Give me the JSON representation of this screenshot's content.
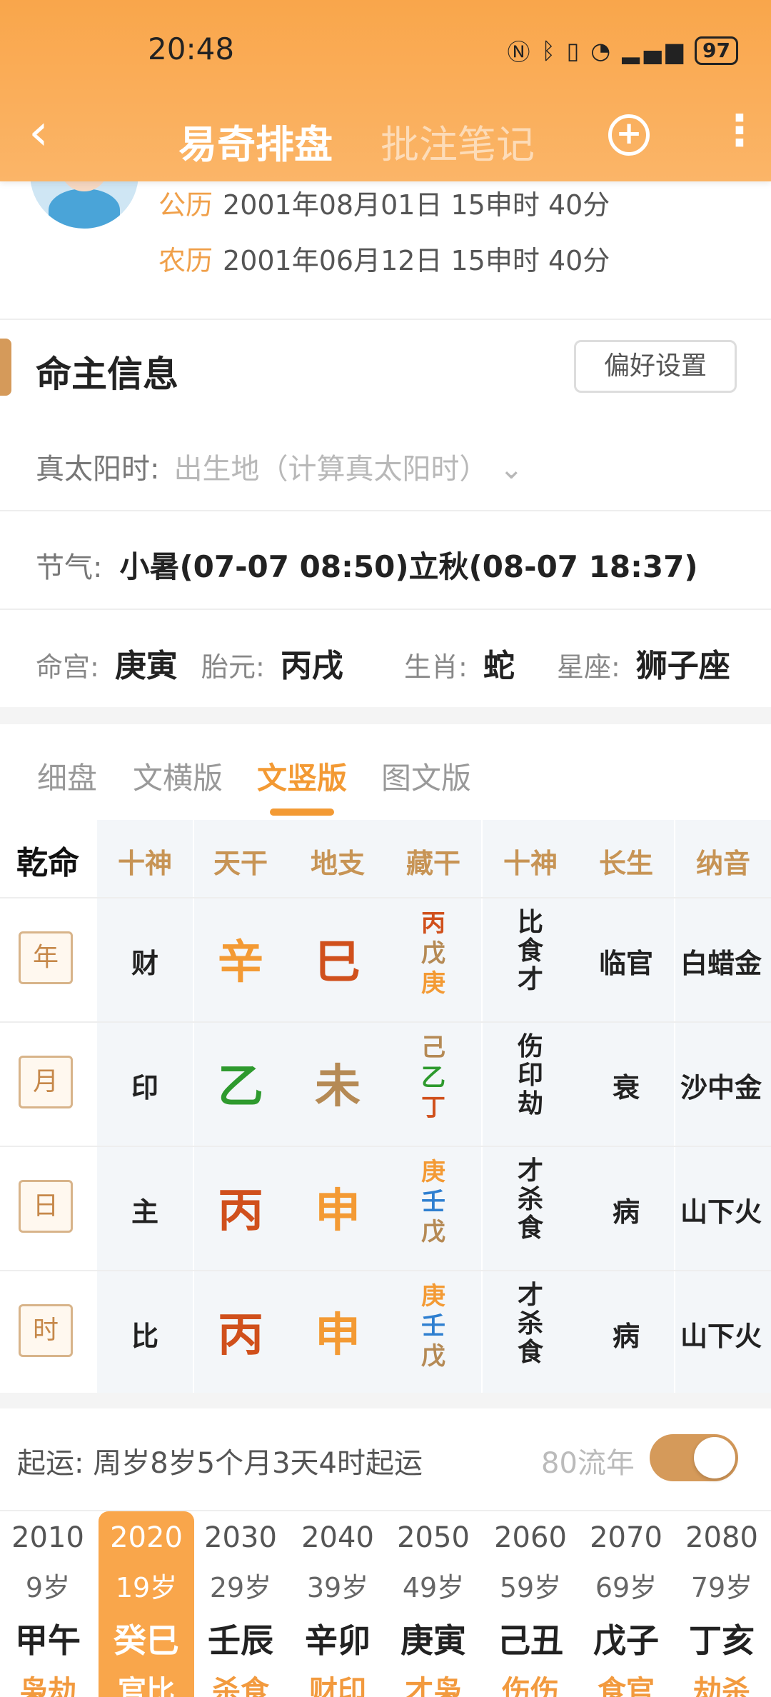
{
  "status": {
    "time": "20:48",
    "battery": "97",
    "icons": "NFC · BT · vibrate · wifi · 5G"
  },
  "nav": {
    "active_tab": "易奇排盘",
    "tab2": "批注笔记",
    "back": "‹",
    "more": "⋮",
    "plus": "+"
  },
  "birth": {
    "gongli_label": "公历",
    "gongli": "2001年08月01日 15申时 40分",
    "nongli_label": "农历",
    "nongli": "2001年06月12日 15申时 40分"
  },
  "section": {
    "title": "命主信息",
    "pref_button": "偏好设置"
  },
  "solar_time": {
    "label": "真太阳时:",
    "placeholder": "出生地（计算真太阳时）",
    "chevron": "⌄"
  },
  "jieqi": {
    "label": "节气:",
    "value": "小暑(07-07 08:50)立秋(08-07 18:37)"
  },
  "info": {
    "minggong_label": "命宫:",
    "minggong": "庚寅",
    "taiyuan_label": "胎元:",
    "taiyuan": "丙戌",
    "shengxiao_label": "生肖:",
    "shengxiao": "蛇",
    "xingzuo_label": "星座:",
    "xingzuo": "狮子座"
  },
  "view_tabs": [
    "细盘",
    "文横版",
    "文竖版",
    "图文版"
  ],
  "chart": {
    "headers": [
      "乾命",
      "十神",
      "天干",
      "地支",
      "藏干",
      "十神",
      "长生",
      "纳音"
    ],
    "rows": [
      {
        "pillar": "年",
        "shishen": "财",
        "gan": "辛",
        "zhi": "巳",
        "zang": [
          "丙",
          "戊",
          "庚"
        ],
        "ss": [
          "比",
          "食",
          "才"
        ],
        "cs": "临官",
        "ny": "白蜡金"
      },
      {
        "pillar": "月",
        "shishen": "印",
        "gan": "乙",
        "zhi": "未",
        "zang": [
          "己",
          "乙",
          "丁"
        ],
        "ss": [
          "伤",
          "印",
          "劫"
        ],
        "cs": "衰",
        "ny": "沙中金"
      },
      {
        "pillar": "日",
        "shishen": "主",
        "gan": "丙",
        "zhi": "申",
        "zang": [
          "庚",
          "壬",
          "戊"
        ],
        "ss": [
          "才",
          "杀",
          "食"
        ],
        "cs": "病",
        "ny": "山下火"
      },
      {
        "pillar": "时",
        "shishen": "比",
        "gan": "丙",
        "zhi": "申",
        "zang": [
          "庚",
          "壬",
          "戊"
        ],
        "ss": [
          "才",
          "杀",
          "食"
        ],
        "cs": "病",
        "ny": "山下火"
      }
    ]
  },
  "qiyun": {
    "label": "起运:",
    "value": "周岁8岁5个月3天4时起运",
    "liunian_label": "80流年"
  },
  "dayun": [
    {
      "year": "2010",
      "age": "9岁",
      "gz": "甲午",
      "ss": "枭劫"
    },
    {
      "year": "2020",
      "age": "19岁",
      "gz": "癸巳",
      "ss": "官比"
    },
    {
      "year": "2030",
      "age": "29岁",
      "gz": "壬辰",
      "ss": "杀食"
    },
    {
      "year": "2040",
      "age": "39岁",
      "gz": "辛卯",
      "ss": "财印"
    },
    {
      "year": "2050",
      "age": "49岁",
      "gz": "庚寅",
      "ss": "才枭"
    },
    {
      "year": "2060",
      "age": "59岁",
      "gz": "己丑",
      "ss": "伤伤"
    },
    {
      "year": "2070",
      "age": "69岁",
      "gz": "戊子",
      "ss": "食官"
    },
    {
      "year": "2080",
      "age": "79岁",
      "gz": "丁亥",
      "ss": "劫杀"
    }
  ],
  "colors": {
    "accent": "#f39a34",
    "fire": "#d0501c",
    "wood": "#2e9a2e",
    "water": "#2e7fd0",
    "earth": "#b58a55",
    "metal": "#f39a34"
  }
}
